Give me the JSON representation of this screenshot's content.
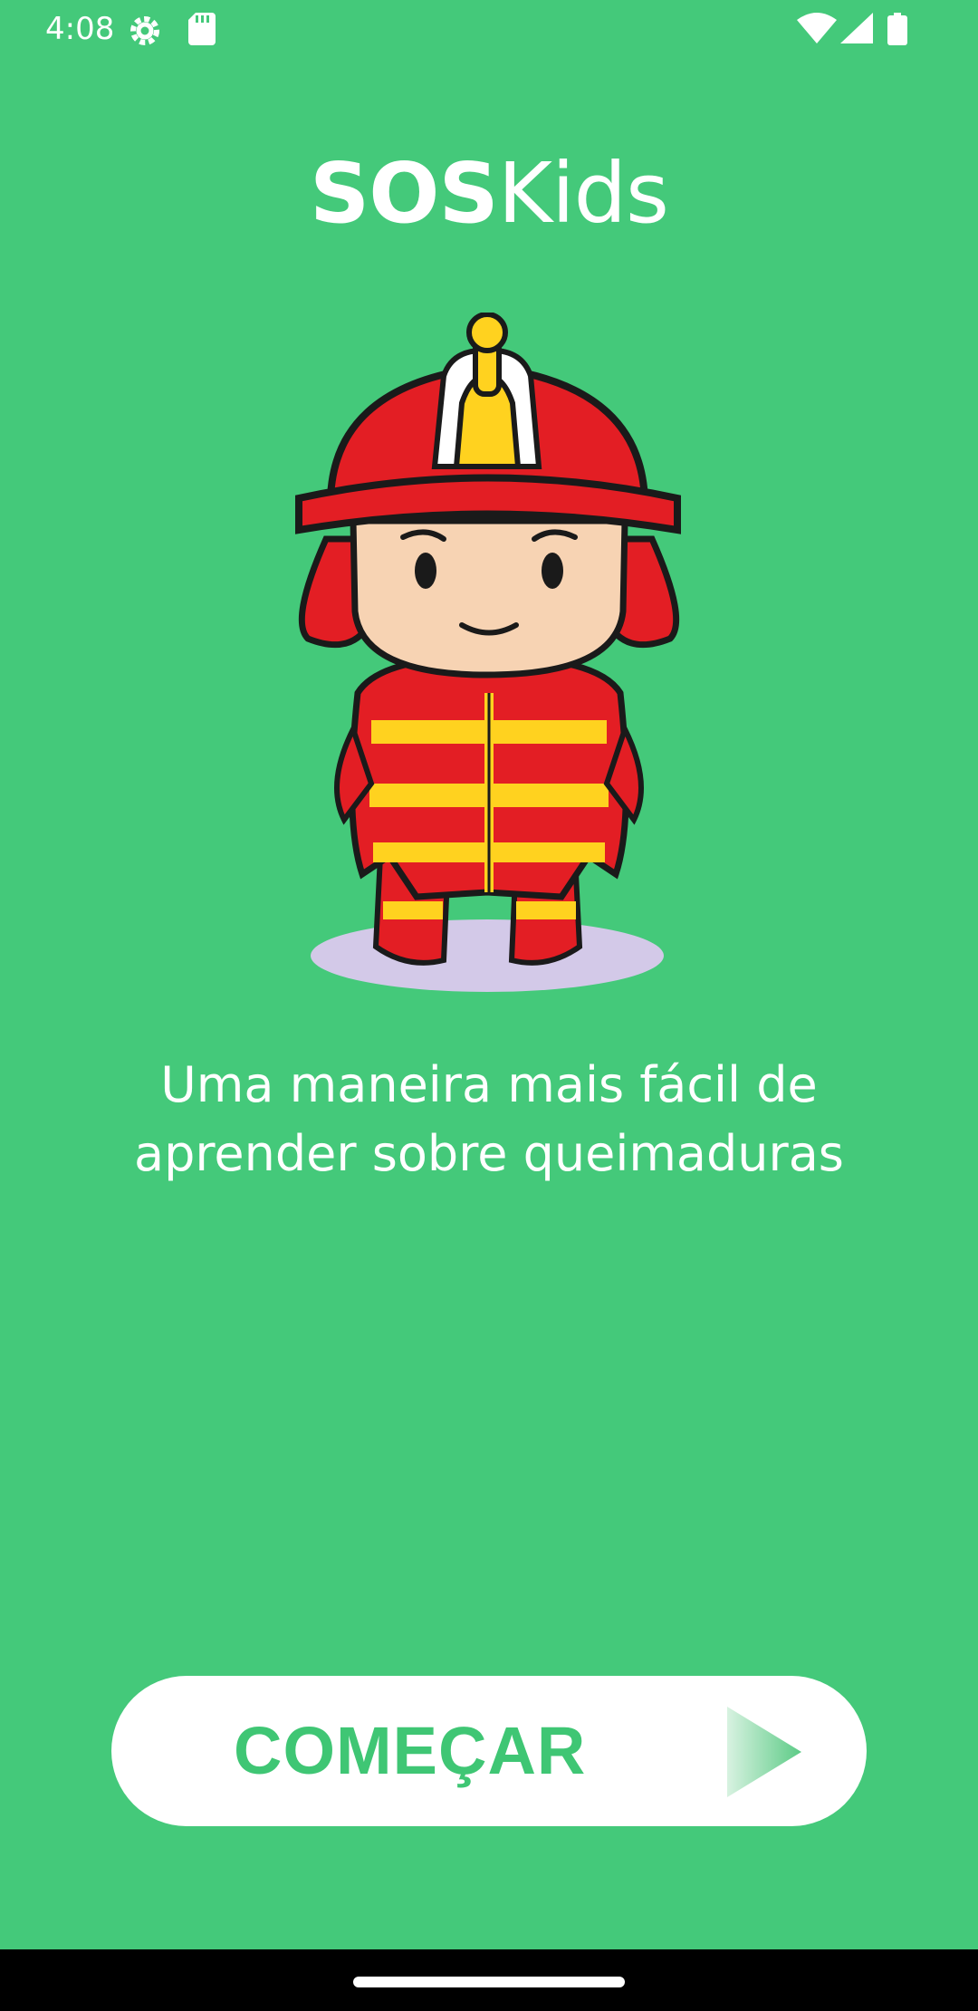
{
  "status_bar": {
    "time": "4:08",
    "icons": [
      "settings-gear-icon",
      "sd-card-icon",
      "wifi-icon",
      "cell-signal-icon",
      "battery-icon"
    ]
  },
  "app": {
    "title_bold": "SOS",
    "title_rest": "Kids",
    "hero_image": "firefighter-kid-illustration",
    "subtitle": "Uma maneira mais fácil de aprender sobre queimaduras",
    "start_button": {
      "label": "COMEÇAR",
      "icon": "play-arrow-icon"
    }
  },
  "colors": {
    "background": "#44C97A",
    "button_bg": "#FFFFFF",
    "button_text": "#3FC674",
    "helmet_red": "#E31E24",
    "helmet_gold": "#FFD21F"
  },
  "nav": {
    "home_indicator": "home-gesture-pill"
  }
}
